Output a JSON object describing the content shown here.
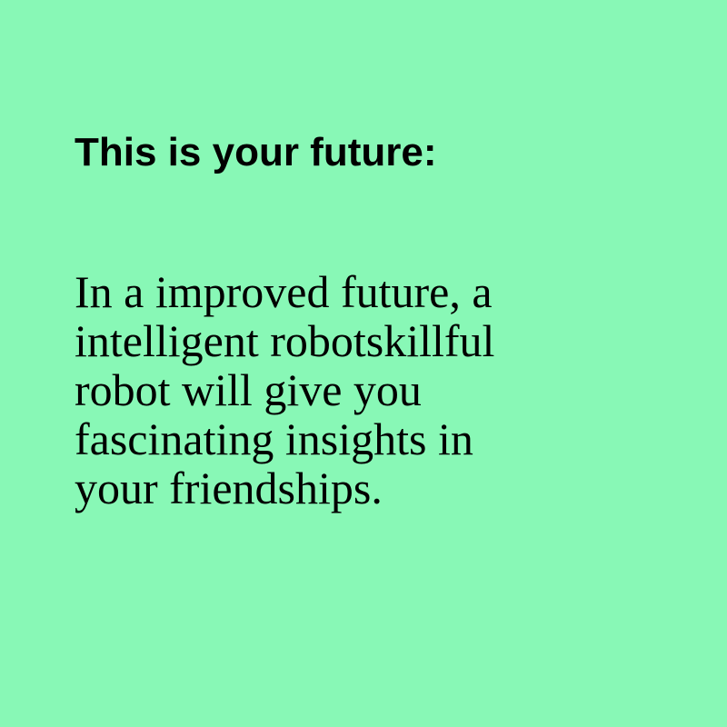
{
  "colors": {
    "background": "#88F8B6",
    "text": "#000000"
  },
  "card": {
    "heading": "This is your future:",
    "body_lines": [
      "In a improved future, a",
      "intelligent robotskillful",
      "robot will give you",
      "fascinating insights in",
      "your friendships."
    ]
  }
}
